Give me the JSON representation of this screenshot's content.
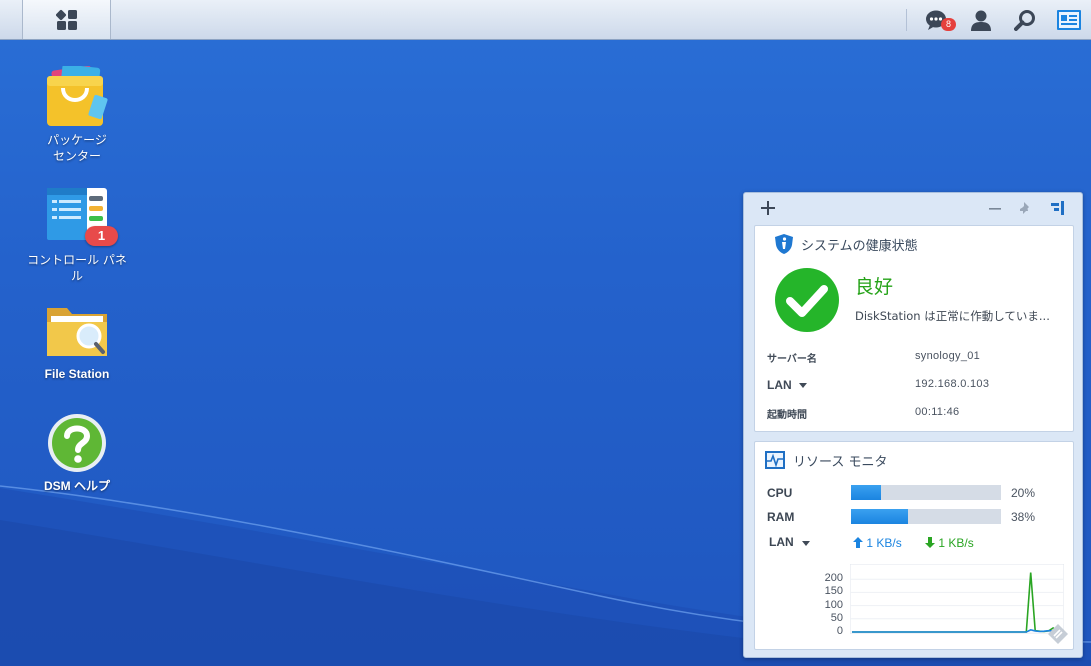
{
  "taskbar": {
    "main_menu_icon": "grid-apps-icon",
    "icons": [
      "notifications-chat-icon",
      "user-icon",
      "search-icon",
      "widgets-toggle-icon"
    ],
    "notification_count": "8"
  },
  "desktop": {
    "icons": [
      {
        "label_line1": "パッケージ",
        "label_line2": "センター",
        "icon": "package-center-icon"
      },
      {
        "label": "コントロール パネル",
        "icon": "control-panel-icon",
        "badge": "1"
      },
      {
        "label": "File Station",
        "icon": "file-station-icon"
      },
      {
        "label": "DSM ヘルプ",
        "icon": "help-icon"
      }
    ]
  },
  "widgets": {
    "toolbar": {
      "add": "+",
      "icons": [
        "add-icon",
        "minimize-icon",
        "pin-icon",
        "widget-layout-icon"
      ]
    },
    "health": {
      "title": "システムの健康状態",
      "status": "良好",
      "description": "DiskStation は正常に作動していま...",
      "rows": [
        {
          "key": "サーバー名",
          "value": "synology_01"
        },
        {
          "key": "LAN",
          "value": "192.168.0.103"
        },
        {
          "key": "起動時間",
          "value": "00:11:46"
        }
      ]
    },
    "resource": {
      "title": "リソース モニタ",
      "cpu": {
        "label": "CPU",
        "percent": 20,
        "text": "20%"
      },
      "ram": {
        "label": "RAM",
        "percent": 38,
        "text": "38%"
      },
      "lan": {
        "label": "LAN",
        "upload": "1 KB/s",
        "download": "1 KB/s"
      },
      "colors": {
        "upload": "#1b84e0",
        "download": "#2aa523",
        "bar": "#1b84e0"
      },
      "chart_data": {
        "type": "line",
        "y_ticks": [
          "200",
          "150",
          "100",
          "50",
          "0"
        ],
        "ylim": [
          0,
          240
        ],
        "series": [
          {
            "values": [
              0,
              0,
              0,
              0,
              0,
              0,
              0,
              0,
              0,
              0,
              0,
              0,
              0,
              0,
              0,
              0,
              0,
              0,
              0,
              0,
              0,
              0,
              0,
              0,
              0,
              0,
              0,
              0,
              0,
              0,
              0,
              0,
              0,
              0,
              0,
              0,
              0,
              0,
              0,
              0,
              225,
              5,
              3,
              2,
              4,
              15,
              3,
              2
            ]
          },
          {
            "values": [
              0,
              0,
              0,
              0,
              0,
              0,
              0,
              0,
              0,
              0,
              0,
              0,
              0,
              0,
              0,
              0,
              0,
              0,
              0,
              0,
              0,
              0,
              0,
              0,
              0,
              0,
              0,
              0,
              0,
              0,
              0,
              0,
              0,
              0,
              0,
              0,
              0,
              0,
              0,
              0,
              8,
              4,
              2,
              3,
              5,
              4,
              2,
              1
            ]
          }
        ]
      }
    }
  }
}
